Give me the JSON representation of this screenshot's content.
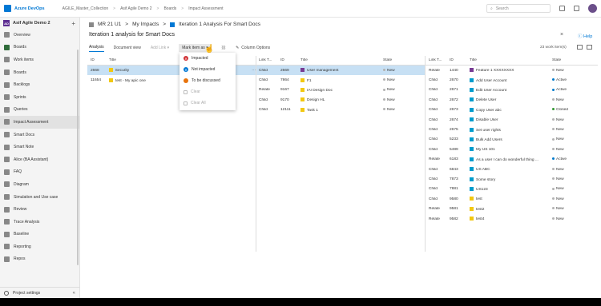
{
  "topbar": {
    "org": "Azure DevOps",
    "crumbs": [
      "AGILE_Master_Collection",
      "Asif Agile Demo 2",
      "Boards",
      "Impact Assessment"
    ],
    "search_placeholder": "Search"
  },
  "sidebar": {
    "project_badge": "AD",
    "project": "Asif Agile Demo 2",
    "plus": "+",
    "items": [
      {
        "label": "Overview",
        "selected": false
      },
      {
        "label": "Boards",
        "selected": false,
        "group": true
      },
      {
        "label": "Work items",
        "selected": false
      },
      {
        "label": "Boards",
        "selected": false
      },
      {
        "label": "Backlogs",
        "selected": false
      },
      {
        "label": "Sprints",
        "selected": false
      },
      {
        "label": "Queries",
        "selected": false
      },
      {
        "label": "Impact Assessment",
        "selected": true
      },
      {
        "label": "Smart Docs",
        "selected": false
      },
      {
        "label": "Smart Note",
        "selected": false
      },
      {
        "label": "Alice (BA Assistant)",
        "selected": false
      },
      {
        "label": "FAQ",
        "selected": false
      },
      {
        "label": "Diagram",
        "selected": false
      },
      {
        "label": "Simulation and Use case",
        "selected": false
      },
      {
        "label": "Review",
        "selected": false
      },
      {
        "label": "Trace Analysis",
        "selected": false
      },
      {
        "label": "Baseline",
        "selected": false
      },
      {
        "label": "Reporting",
        "selected": false
      },
      {
        "label": "Repos",
        "selected": false
      }
    ],
    "footer": "Project settings",
    "collapse": "«"
  },
  "main": {
    "breadcrumb": [
      "MR 21 U1",
      "My Impacts",
      "Iteration 1 Analysis For Smart Docs"
    ],
    "crumb_sep": ">",
    "title": "Iteration 1 analysis for Smart Docs",
    "close": "×",
    "help": "Help",
    "tabs": {
      "analysis": "Analysis",
      "document_view": "Document view",
      "add_link": "Add Link",
      "mark_item_as": "Mark item as",
      "column_options": "Column Options"
    },
    "count": "23 work item(s)"
  },
  "dropdown": {
    "items": [
      {
        "label": "Impacted",
        "color": "#d13438",
        "glyph": "✕"
      },
      {
        "label": "Not impacted",
        "color": "#0078d4",
        "glyph": "✕"
      },
      {
        "label": "To be discussed",
        "color": "#e8730c",
        "glyph": ""
      },
      {
        "label": "Clear",
        "disabled": true
      },
      {
        "label": "Clear All",
        "disabled": true
      }
    ]
  },
  "grid1": {
    "headers": [
      "ID",
      "Title"
    ],
    "rows": [
      {
        "id": "2668",
        "title": "Security",
        "color": "#f2c811",
        "selected": true
      },
      {
        "id": "11654",
        "title": "test - My apic one",
        "color": "#f2c811",
        "selected": false
      }
    ]
  },
  "grid2": {
    "headers": [
      "Link T...",
      "ID",
      "Title",
      "State"
    ],
    "rows": [
      {
        "link": "Child",
        "id": "2669",
        "title": "User management",
        "color": "#773b93",
        "state": "New",
        "selected": true
      },
      {
        "link": "Child",
        "id": "7864",
        "title": "F1",
        "color": "#f2c811",
        "state": "New"
      },
      {
        "link": "Relate",
        "id": "9167",
        "title": "IAI Design Doc",
        "color": "#f2c811",
        "state": "New"
      },
      {
        "link": "Child",
        "id": "9170",
        "title": "Design HL",
        "color": "#f2c811",
        "state": "New"
      },
      {
        "link": "Child",
        "id": "12111",
        "title": "Task 1",
        "color": "#f2c811",
        "state": "New"
      }
    ]
  },
  "grid3": {
    "headers": [
      "Link T...",
      "ID",
      "Title",
      "State"
    ],
    "rows": [
      {
        "link": "Relate",
        "id": "1440",
        "title": "Feature 1 XXXXXXXX",
        "color": "#773b93",
        "state": "New",
        "sc": "#b2b2b2"
      },
      {
        "link": "Child",
        "id": "2670",
        "title": "Add User Account",
        "color": "#009ccc",
        "state": "Active",
        "sc": "#007acc"
      },
      {
        "link": "Child",
        "id": "2671",
        "title": "Edit User Account",
        "color": "#009ccc",
        "state": "Active",
        "sc": "#007acc"
      },
      {
        "link": "Child",
        "id": "2672",
        "title": "Delete User",
        "color": "#009ccc",
        "state": "New",
        "sc": "#b2b2b2"
      },
      {
        "link": "Child",
        "id": "2673",
        "title": "Copy User abc",
        "color": "#009ccc",
        "state": "Closed",
        "sc": "#339933"
      },
      {
        "link": "Child",
        "id": "2674",
        "title": "Disable User",
        "color": "#009ccc",
        "state": "New",
        "sc": "#b2b2b2"
      },
      {
        "link": "Child",
        "id": "2675",
        "title": "Set user rights",
        "color": "#009ccc",
        "state": "New",
        "sc": "#b2b2b2"
      },
      {
        "link": "Child",
        "id": "5233",
        "title": "Bulk Add Users",
        "color": "#009ccc",
        "state": "New",
        "sc": "#b2b2b2"
      },
      {
        "link": "Child",
        "id": "5489",
        "title": "My US 101",
        "color": "#009ccc",
        "state": "New",
        "sc": "#b2b2b2"
      },
      {
        "link": "Relate",
        "id": "6183",
        "title": "As a user I can do wonderful thing ...",
        "color": "#009ccc",
        "state": "Active",
        "sc": "#007acc"
      },
      {
        "link": "Child",
        "id": "6843",
        "title": "US ABC",
        "color": "#009ccc",
        "state": "New",
        "sc": "#b2b2b2"
      },
      {
        "link": "Child",
        "id": "7873",
        "title": "Some story",
        "color": "#009ccc",
        "state": "New",
        "sc": "#b2b2b2"
      },
      {
        "link": "Child",
        "id": "7881",
        "title": "US123",
        "color": "#009ccc",
        "state": "New",
        "sc": "#b2b2b2"
      },
      {
        "link": "Child",
        "id": "9580",
        "title": "test",
        "color": "#f2c811",
        "state": "New",
        "sc": "#b2b2b2"
      },
      {
        "link": "Relate",
        "id": "9581",
        "title": "test2",
        "color": "#f2c811",
        "state": "New",
        "sc": "#b2b2b2"
      },
      {
        "link": "Relate",
        "id": "9582",
        "title": "test4",
        "color": "#f2c811",
        "state": "New",
        "sc": "#b2b2b2"
      }
    ]
  }
}
